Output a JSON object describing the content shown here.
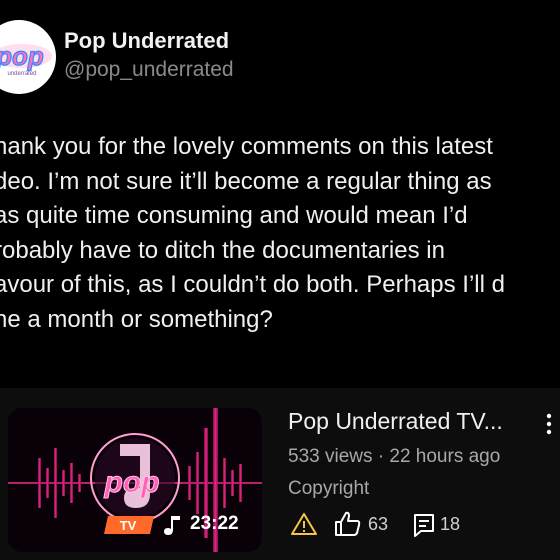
{
  "account": {
    "display_name": "Pop Underrated",
    "handle": "@pop_underrated",
    "avatar_logo_text": "pop",
    "avatar_logo_subtext": "underrated"
  },
  "post": {
    "lines": [
      "hank you for the lovely comments on this latest",
      "deo. I’m not sure it’ll become a regular thing as",
      "as quite time consuming and would mean I’d",
      "robably have to ditch the documentaries in",
      "avour of this, as I couldn’t do both. Perhaps I’ll d",
      "ne a month or something?"
    ]
  },
  "video": {
    "title": "Pop Underrated TV...",
    "views_time": "533 views · 22 hours ago",
    "copyright": "Copyright",
    "likes": "63",
    "comments": "18",
    "duration": "23:22",
    "badge": "TV",
    "thumb_logo_text": "pop"
  },
  "colors": {
    "accent_pink": "#ff2f9a",
    "avatar_bg": "#ffffff",
    "card_bg": "#0d0d0d"
  },
  "icons": [
    "warning-icon",
    "thumbs-up-icon",
    "comment-icon",
    "more-vertical-icon",
    "music-note-icon"
  ]
}
